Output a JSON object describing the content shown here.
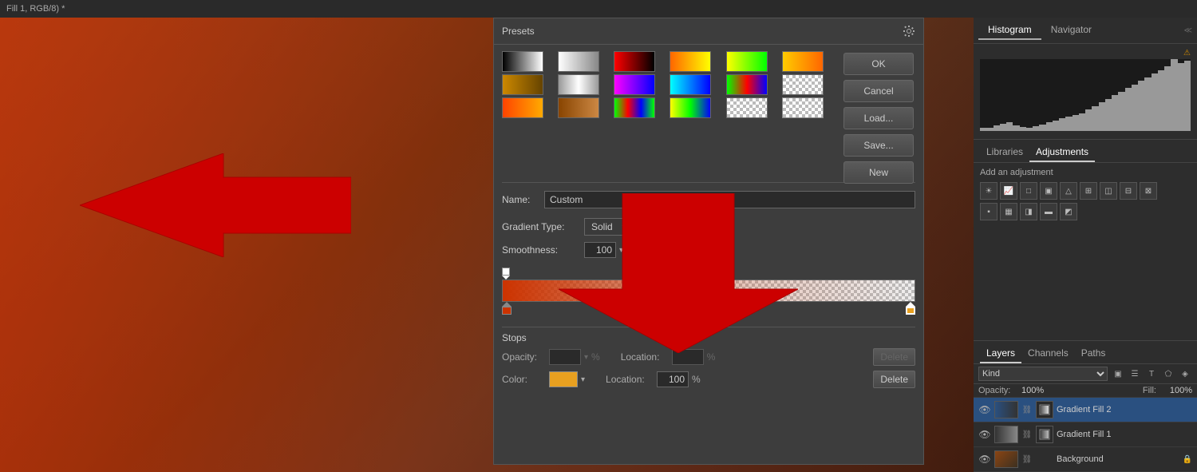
{
  "titleBar": {
    "text": "Fill 1, RGB/8) *"
  },
  "dialog": {
    "title": "Presets",
    "name_label": "Name:",
    "name_value": "Custom",
    "gradient_type_label": "Gradient Type:",
    "gradient_type_value": "Solid",
    "smoothness_label": "Smoothness:",
    "smoothness_value": "100",
    "smoothness_unit": "%",
    "stops_title": "Stops",
    "opacity_label": "Opacity:",
    "opacity_unit": "%",
    "location_label": "Location:",
    "location_unit": "%",
    "delete_label1": "Delete",
    "color_label": "Color:",
    "location_label2": "Location:",
    "location_value2": "100",
    "location_unit2": "%",
    "delete_label2": "Delete",
    "buttons": {
      "ok": "OK",
      "cancel": "Cancel",
      "load": "Load...",
      "save": "Save...",
      "new": "New"
    }
  },
  "rightPanel": {
    "top_tabs": [
      "Histogram",
      "Navigator"
    ],
    "active_top_tab": "Histogram",
    "adj_tabs": [
      "Libraries",
      "Adjustments"
    ],
    "active_adj_tab": "Adjustments",
    "add_adjustment_label": "Add an adjustment",
    "layers_tabs": [
      "Layers",
      "Channels",
      "Paths"
    ],
    "active_layers_tab": "Layers",
    "opacity_label": "Opacity:",
    "opacity_value": "100%",
    "fill_label": "Fill:",
    "fill_value": "100%",
    "layers": [
      {
        "name": "Gradient Fill 2",
        "visible": true,
        "type": "gradient2",
        "selected": true
      },
      {
        "name": "Gradient Fill 1",
        "visible": true,
        "type": "gradient1",
        "selected": false
      },
      {
        "name": "Background",
        "visible": true,
        "type": "photo",
        "selected": false,
        "locked": true
      }
    ]
  }
}
